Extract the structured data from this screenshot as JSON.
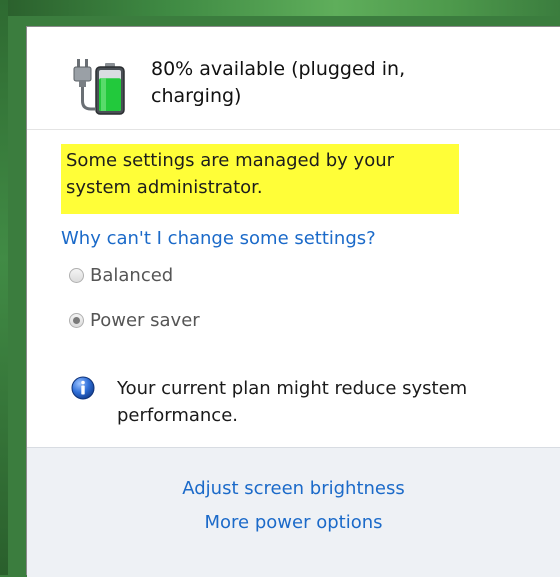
{
  "battery": {
    "status": "80% available (plugged in, charging)",
    "percent": 80,
    "icon": "battery-charging-icon"
  },
  "notice": {
    "managed_text": "Some settings are managed by your system administrator.",
    "highlight_color": "#fffe38"
  },
  "help_link": "Why can't I change some settings?",
  "plans": [
    {
      "label": "Balanced",
      "selected": false
    },
    {
      "label": "Power saver",
      "selected": true
    }
  ],
  "info": {
    "icon": "info-icon",
    "text": "Your current plan might reduce system performance."
  },
  "footer": {
    "brightness_link": "Adjust screen brightness",
    "power_options_link": "More power options"
  },
  "colors": {
    "link": "#1b6ac9",
    "battery_fill": "#22c93c",
    "desktop": "#3b7d3e"
  }
}
